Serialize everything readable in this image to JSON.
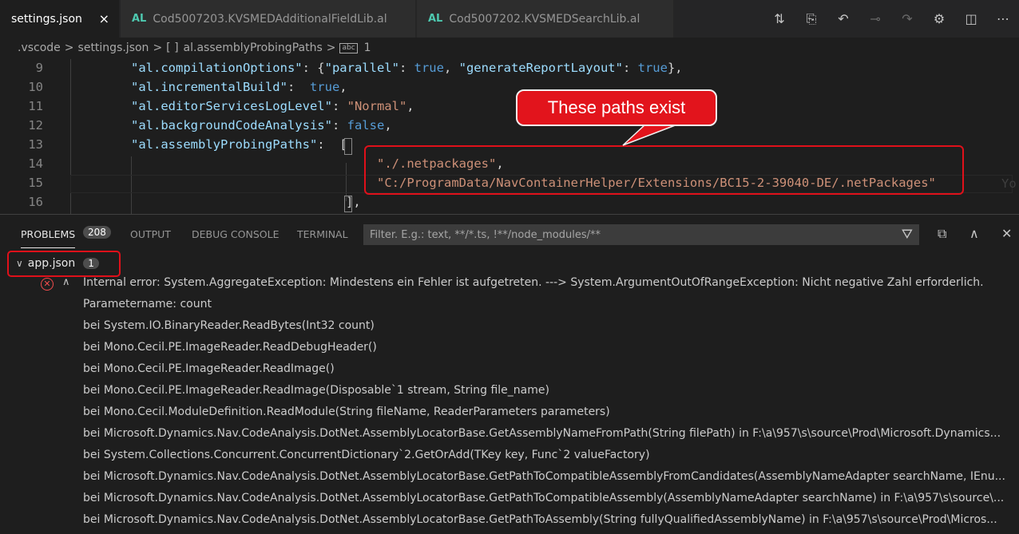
{
  "tabs": [
    {
      "label": "settings.json",
      "icon": "json-file-icon",
      "active": true,
      "close": "×"
    },
    {
      "label": "Cod5007203.KVSMEDAdditionalFieldLib.al",
      "icon_text": "AL"
    },
    {
      "label": "Cod5007202.KVSMEDSearchLib.al",
      "icon_text": "AL"
    }
  ],
  "breadcrumb": {
    "folder": ".vscode",
    "file": "settings.json",
    "bracket": "[ ]",
    "key": "al.assemblyProbingPaths",
    "abc": "abc",
    "index": "1",
    "sep": ">"
  },
  "editor": {
    "lines": [
      {
        "n": "9"
      },
      {
        "n": "10"
      },
      {
        "n": "11"
      },
      {
        "n": "12"
      },
      {
        "n": "13"
      },
      {
        "n": "14"
      },
      {
        "n": "15"
      },
      {
        "n": "16"
      }
    ],
    "tokens": {
      "l9": {
        "k1": "\"al.compilationOptions\"",
        "p1": ": {",
        "k2": "\"parallel\"",
        "p2": ": ",
        "b1": "true",
        "p3": ", ",
        "k3": "\"generateReportLayout\"",
        "p4": ": ",
        "b2": "true",
        "p5": "},"
      },
      "l10": {
        "k": "\"al.incrementalBuild\"",
        "p1": ":  ",
        "b": "true",
        "p2": ","
      },
      "l11": {
        "k": "\"al.editorServicesLogLevel\"",
        "p1": ": ",
        "s": "\"Normal\"",
        "p2": ","
      },
      "l12": {
        "k": "\"al.backgroundCodeAnalysis\"",
        "p1": ": ",
        "b": "false",
        "p2": ","
      },
      "l13": {
        "k": "\"al.assemblyProbingPaths\"",
        "p1": ":  ",
        "p2": "["
      },
      "l14": {
        "s": "\"./.netpackages\"",
        "p": ","
      },
      "l15": {
        "s": "\"C:/ProgramData/NavContainerHelper/Extensions/BC15-2-39040-DE/.netPackages\""
      },
      "l16": {
        "p": "],"
      }
    },
    "ghost_text": "Yo"
  },
  "callout": {
    "text": "These paths exist",
    "color": "#e2141c"
  },
  "panel": {
    "tabs": [
      "PROBLEMS",
      "OUTPUT",
      "DEBUG CONSOLE",
      "TERMINAL"
    ],
    "problem_count": "208",
    "filter_placeholder": "Filter. E.g.: text, **/*.ts, !**/node_modules/**",
    "group": {
      "name": "app.json",
      "count": "1"
    },
    "messages": [
      "Internal error: System.AggregateException: Mindestens ein Fehler ist aufgetreten. ---> System.ArgumentOutOfRangeException: Nicht negative Zahl erforderlich.",
      "Parametername: count",
      "bei System.IO.BinaryReader.ReadBytes(Int32 count)",
      "bei Mono.Cecil.PE.ImageReader.ReadDebugHeader()",
      "bei Mono.Cecil.PE.ImageReader.ReadImage()",
      "bei Mono.Cecil.PE.ImageReader.ReadImage(Disposable`1 stream, String file_name)",
      "bei Mono.Cecil.ModuleDefinition.ReadModule(String fileName, ReaderParameters parameters)",
      "bei Microsoft.Dynamics.Nav.CodeAnalysis.DotNet.AssemblyLocatorBase.GetAssemblyNameFromPath(String filePath) in F:\\a\\957\\s\\source\\Prod\\Microsoft.Dynamics...",
      "bei System.Collections.Concurrent.ConcurrentDictionary`2.GetOrAdd(TKey key, Func`2 valueFactory)",
      "bei Microsoft.Dynamics.Nav.CodeAnalysis.DotNet.AssemblyLocatorBase.GetPathToCompatibleAssemblyFromCandidates(AssemblyNameAdapter searchName, IEnu...",
      "bei Microsoft.Dynamics.Nav.CodeAnalysis.DotNet.AssemblyLocatorBase.GetPathToCompatibleAssembly(AssemblyNameAdapter searchName) in F:\\a\\957\\s\\source\\...",
      "bei Microsoft.Dynamics.Nav.CodeAnalysis.DotNet.AssemblyLocatorBase.GetPathToAssembly(String fullyQualifiedAssemblyName) in F:\\a\\957\\s\\source\\Prod\\Micros..."
    ]
  },
  "colors": {
    "accent_red": "#e0101a",
    "error": "#f14c4c",
    "al_icon": "#4ec9b0"
  }
}
